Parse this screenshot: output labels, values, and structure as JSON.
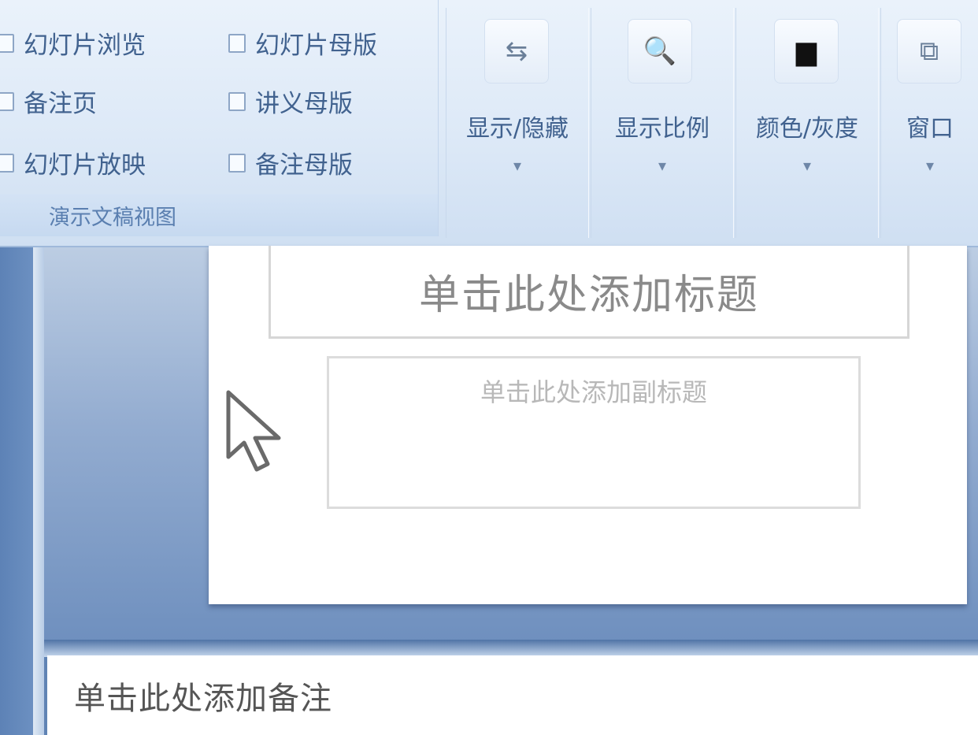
{
  "ribbon": {
    "checkboxes_col1": [
      "幻灯片浏览",
      "备注页",
      "幻灯片放映"
    ],
    "checkboxes_col2": [
      "幻灯片母版",
      "讲义母版",
      "备注母版"
    ],
    "group_label": "演示文稿视图",
    "buttons": [
      {
        "label": "显示/隐藏",
        "icon": "show-hide-icon",
        "glyph": "⇆"
      },
      {
        "label": "显示比例",
        "icon": "zoom-icon",
        "glyph": "🔍"
      },
      {
        "label": "颜色/灰度",
        "icon": "color-grayscale-icon",
        "glyph": "▆"
      },
      {
        "label": "窗口",
        "icon": "window-icon",
        "glyph": "⧉"
      }
    ],
    "dropdown_arrow": "▾"
  },
  "slide": {
    "title_placeholder": "单击此处添加标题",
    "subtitle_placeholder": "单击此处添加副标题"
  },
  "notes": {
    "placeholder": "单击此处添加备注"
  }
}
